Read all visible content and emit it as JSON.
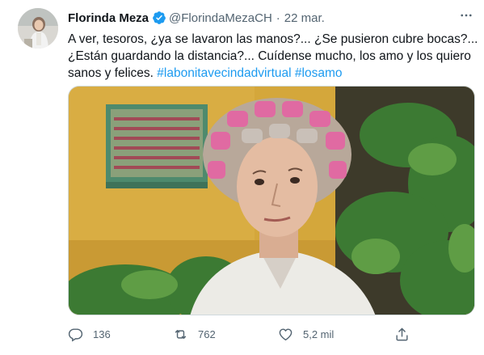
{
  "tweet": {
    "display_name": "Florinda Meza",
    "handle": "@FlorindaMezaCH",
    "separator": "·",
    "timestamp": "22 mar.",
    "text_lines": [
      "A ver, tesoros, ¿ya se lavaron las manos?... ¿Se pusieron cubre bocas?...",
      "¿Están guardando la distancia?... Cuídense mucho, los amo y los quiero",
      "sanos y felices."
    ],
    "hashtags": [
      "#labonitavecindadvirtual",
      "#losamo"
    ]
  },
  "actions": {
    "reply_count": "136",
    "retweet_count": "762",
    "like_count": "5,2 mil"
  },
  "icons": {
    "verified": "verified-badge-icon",
    "more": "more-options-icon",
    "reply": "reply-icon",
    "retweet": "retweet-icon",
    "like": "heart-icon",
    "share": "share-icon"
  },
  "colors": {
    "accent": "#1d9bf0",
    "secondary_text": "#536471",
    "primary_text": "#0f1419"
  }
}
